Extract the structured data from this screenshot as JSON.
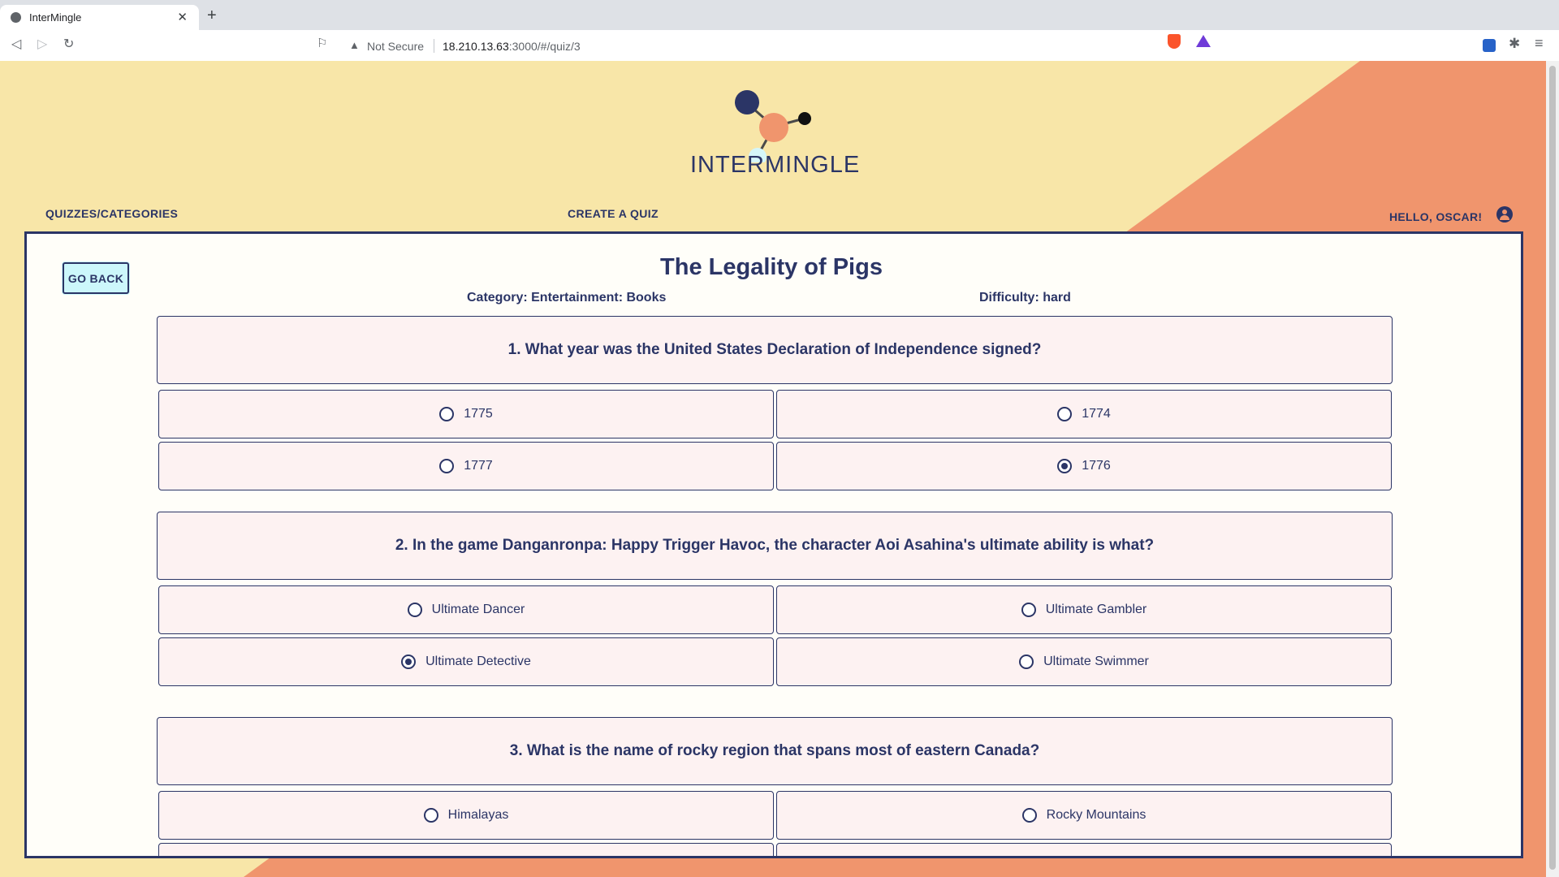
{
  "browser": {
    "tab_title": "InterMingle",
    "security_label": "Not Secure",
    "url_host": "18.210.13.63",
    "url_path": ":3000/#/quiz/3"
  },
  "brand": {
    "name": "INTERMINGLE"
  },
  "nav": {
    "quizzes": "QUIZZES/CATEGORIES",
    "create": "CREATE A QUIZ",
    "greeting": "HELLO, OSCAR!"
  },
  "quiz": {
    "go_back": "GO BACK",
    "title": "The Legality of Pigs",
    "category": "Category: Entertainment: Books",
    "difficulty": "Difficulty: hard",
    "questions": [
      {
        "text": "1. What year was the United States Declaration of Independence signed?",
        "options": [
          {
            "label": "1775",
            "checked": false
          },
          {
            "label": "1774",
            "checked": false
          },
          {
            "label": "1777",
            "checked": false
          },
          {
            "label": "1776",
            "checked": true
          }
        ]
      },
      {
        "text": "2. In the game Danganronpa: Happy Trigger Havoc, the character Aoi Asahina's ultimate ability is what?",
        "options": [
          {
            "label": "Ultimate Dancer",
            "checked": false
          },
          {
            "label": "Ultimate Gambler",
            "checked": false
          },
          {
            "label": "Ultimate Detective",
            "checked": true
          },
          {
            "label": "Ultimate Swimmer",
            "checked": false
          }
        ]
      },
      {
        "text": "3. What is the name of rocky region that spans most of eastern Canada?",
        "options": [
          {
            "label": "Himalayas",
            "checked": false
          },
          {
            "label": "Rocky Mountains",
            "checked": false
          }
        ]
      }
    ]
  },
  "colors": {
    "navy": "#2b3566",
    "yellow_bg": "#f8e6a8",
    "orange_bg": "#f0956d",
    "card_bg": "#fffef9",
    "option_bg": "#fdf2f2",
    "button_bg": "#ccf7fb"
  }
}
